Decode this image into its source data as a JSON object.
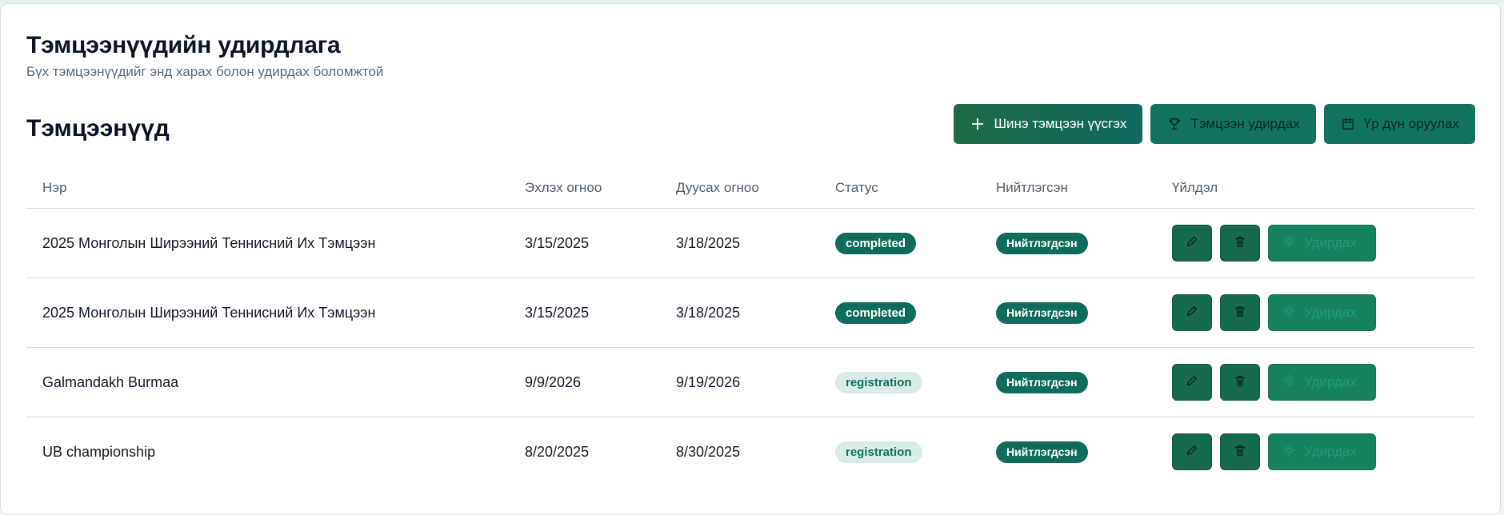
{
  "header": {
    "title": "Тэмцээнүүдийн удирдлага",
    "subtitle": "Бүх тэмцээнүүдийг энд харах болон удирдах боломжтой"
  },
  "section": {
    "title": "Тэмцээнүүд"
  },
  "toolbar": {
    "new_label": "Шинэ тэмцээн үүсгэх",
    "manage_label": "Тэмцээн удирдах",
    "results_label": "Үр дүн оруулах"
  },
  "table": {
    "headers": [
      "Нэр",
      "Эхлэх огноо",
      "Дуусах огноо",
      "Статус",
      "Нийтлэгсэн",
      "Үйлдэл"
    ],
    "rows": [
      {
        "name": "2025 Монголын Ширээний Теннисний Их Тэмцээн",
        "start": "3/15/2025",
        "end": "3/18/2025",
        "status": "completed",
        "published": "Нийтлэгдсэн",
        "manage": "Удирдах"
      },
      {
        "name": "2025 Монголын Ширээний Теннисний Их Тэмцээн",
        "start": "3/15/2025",
        "end": "3/18/2025",
        "status": "completed",
        "published": "Нийтлэгдсэн",
        "manage": "Удирдах"
      },
      {
        "name": "Galmandakh Burmaa",
        "start": "9/9/2026",
        "end": "9/19/2026",
        "status": "registration",
        "published": "Нийтлэгдсэн",
        "manage": "Удирдах"
      },
      {
        "name": "UB championship",
        "start": "8/20/2025",
        "end": "8/30/2025",
        "status": "registration",
        "published": "Нийтлэгдсэн",
        "manage": "Удирдах"
      }
    ]
  },
  "colors": {
    "primary": "#16694e",
    "badge_completed_bg": "#0f6b5b",
    "badge_registration_bg": "#d9ecea"
  },
  "icons": {
    "new": "plus-icon",
    "manage": "trophy-icon",
    "results": "calendar-icon",
    "edit": "pencil-icon",
    "delete": "trash-icon",
    "settings": "gear-icon"
  }
}
